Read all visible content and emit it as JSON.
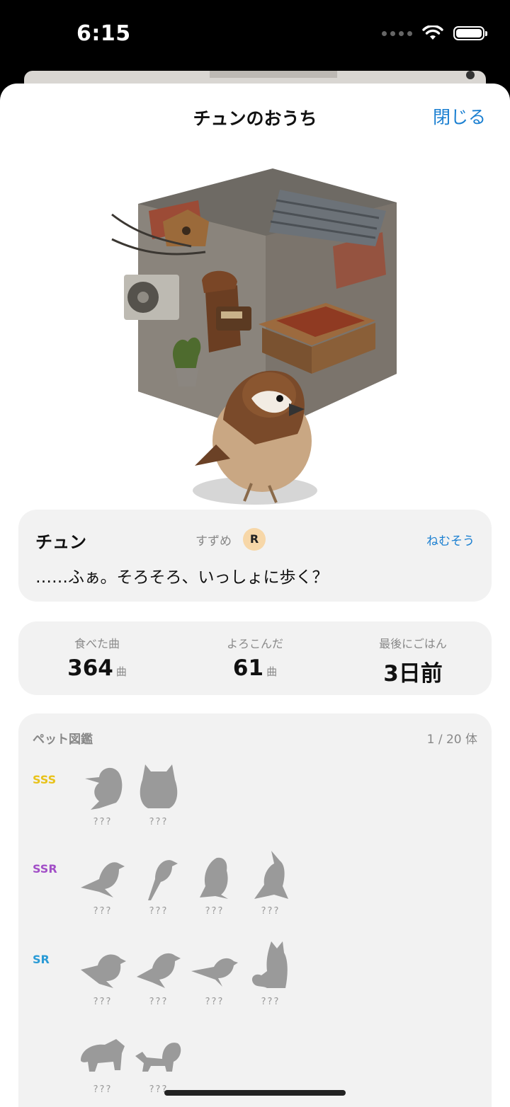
{
  "status_bar": {
    "time": "6:15"
  },
  "header": {
    "title": "チュンのおうち",
    "close_label": "閉じる"
  },
  "pet": {
    "name": "チュン",
    "species": "すずめ",
    "rarity": "R",
    "mood": "ねむそう",
    "speech": "……ふぁ。そろそろ、いっしょに歩く？"
  },
  "stats": [
    {
      "label": "食べた曲",
      "value": "364",
      "unit": "曲"
    },
    {
      "label": "よろこんだ",
      "value": "61",
      "unit": "曲"
    },
    {
      "label": "最後にごはん",
      "value": "3日前",
      "unit": ""
    }
  ],
  "dex": {
    "title": "ペット図鑑",
    "count": "1 / 20 体",
    "tiers": [
      {
        "label": "SSS",
        "color": "#e8c21a",
        "slots": [
          {
            "icon": "kingfisher-silhouette-icon",
            "label": "???"
          },
          {
            "icon": "owl-silhouette-icon",
            "label": "???"
          }
        ]
      },
      {
        "label": "SSR",
        "color": "#a24fc7",
        "slots": [
          {
            "icon": "bird-silhouette-icon",
            "label": "???"
          },
          {
            "icon": "longtail-bird-silhouette-icon",
            "label": "???"
          },
          {
            "icon": "songbird-silhouette-icon",
            "label": "???"
          },
          {
            "icon": "cockatiel-silhouette-icon",
            "label": "???"
          }
        ]
      },
      {
        "label": "SR",
        "color": "#2a9bd6",
        "slots": [
          {
            "icon": "robin-silhouette-icon",
            "label": "???"
          },
          {
            "icon": "finch-silhouette-icon",
            "label": "???"
          },
          {
            "icon": "wagtail-silhouette-icon",
            "label": "???"
          },
          {
            "icon": "shiba-dog-silhouette-icon",
            "label": "???"
          }
        ]
      },
      {
        "label": "",
        "color": "#888888",
        "slots": [
          {
            "icon": "raccoon-dog-silhouette-icon",
            "label": "???"
          },
          {
            "icon": "squirrel-silhouette-icon",
            "label": "???"
          }
        ]
      }
    ]
  },
  "colors": {
    "accent": "#1a7fd1",
    "card_bg": "#f2f2f2",
    "silhouette": "#9a9a9a"
  }
}
